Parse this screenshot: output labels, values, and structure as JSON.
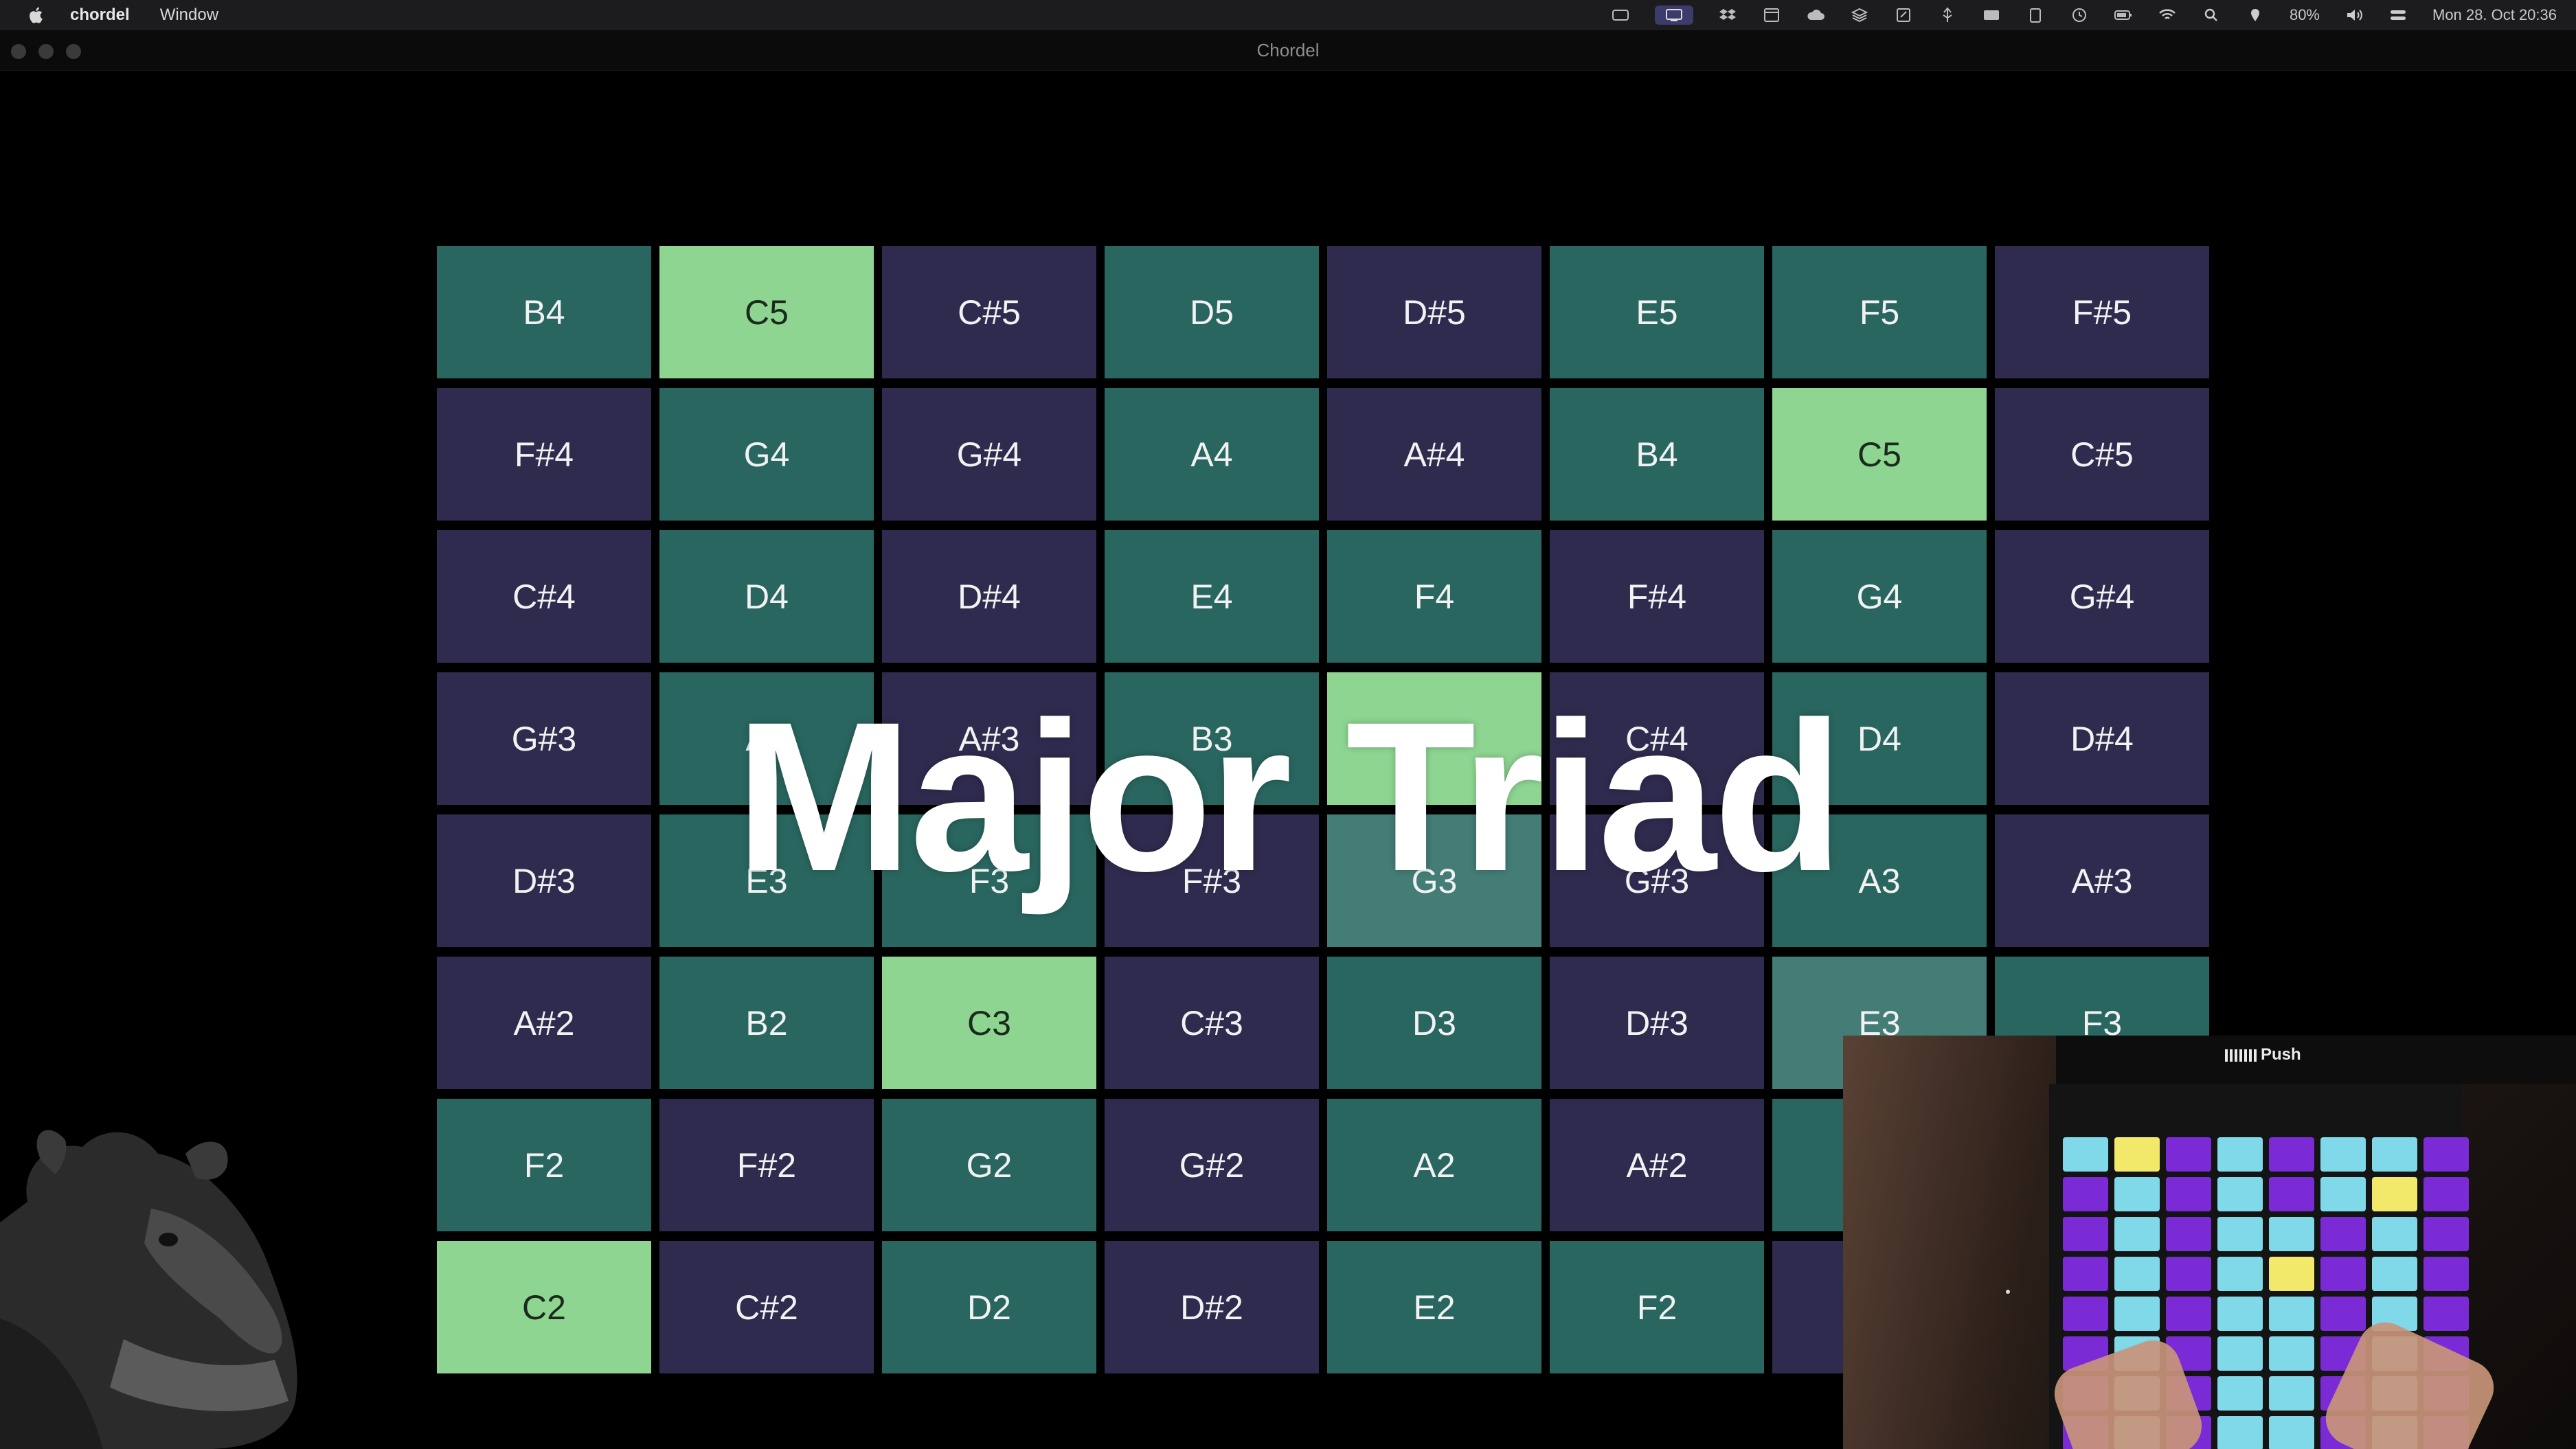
{
  "menubar": {
    "app_name": "chordel",
    "menus": [
      "Window"
    ],
    "battery": "80%",
    "datetime": "Mon 28. Oct  20:36",
    "status_icons": [
      "capture-icon",
      "screen-mirror-icon",
      "dropbox-icon",
      "calendar-icon",
      "cloud-icon",
      "stack-icon",
      "note-icon",
      "usb-icon",
      "card-icon",
      "clipboard-icon",
      "clock-icon",
      "battery-icon",
      "wifi-icon",
      "search-icon",
      "location-icon",
      "volume-icon",
      "control-center-icon"
    ]
  },
  "window": {
    "title": "Chordel"
  },
  "grid": {
    "rows": [
      [
        {
          "note": "B4",
          "kind": "natural"
        },
        {
          "note": "C5",
          "kind": "root"
        },
        {
          "note": "C#5",
          "kind": "sharp"
        },
        {
          "note": "D5",
          "kind": "natural"
        },
        {
          "note": "D#5",
          "kind": "sharp"
        },
        {
          "note": "E5",
          "kind": "natural"
        },
        {
          "note": "F5",
          "kind": "natural"
        },
        {
          "note": "F#5",
          "kind": "sharp"
        }
      ],
      [
        {
          "note": "F#4",
          "kind": "sharp"
        },
        {
          "note": "G4",
          "kind": "natural"
        },
        {
          "note": "G#4",
          "kind": "sharp"
        },
        {
          "note": "A4",
          "kind": "natural"
        },
        {
          "note": "A#4",
          "kind": "sharp"
        },
        {
          "note": "B4",
          "kind": "natural"
        },
        {
          "note": "C5",
          "kind": "root"
        },
        {
          "note": "C#5",
          "kind": "sharp"
        }
      ],
      [
        {
          "note": "C#4",
          "kind": "sharp"
        },
        {
          "note": "D4",
          "kind": "natural"
        },
        {
          "note": "D#4",
          "kind": "sharp"
        },
        {
          "note": "E4",
          "kind": "natural"
        },
        {
          "note": "F4",
          "kind": "natural"
        },
        {
          "note": "F#4",
          "kind": "sharp"
        },
        {
          "note": "G4",
          "kind": "natural"
        },
        {
          "note": "G#4",
          "kind": "sharp"
        }
      ],
      [
        {
          "note": "G#3",
          "kind": "sharp"
        },
        {
          "note": "A3",
          "kind": "natural"
        },
        {
          "note": "A#3",
          "kind": "sharp"
        },
        {
          "note": "B3",
          "kind": "natural"
        },
        {
          "note": "",
          "kind": "root"
        },
        {
          "note": "C#4",
          "kind": "sharp"
        },
        {
          "note": "D4",
          "kind": "natural"
        },
        {
          "note": "D#4",
          "kind": "sharp"
        }
      ],
      [
        {
          "note": "D#3",
          "kind": "sharp"
        },
        {
          "note": "E3",
          "kind": "natural"
        },
        {
          "note": "F3",
          "kind": "natural"
        },
        {
          "note": "F#3",
          "kind": "sharp"
        },
        {
          "note": "G3",
          "kind": "dim"
        },
        {
          "note": "G#3",
          "kind": "sharp"
        },
        {
          "note": "A3",
          "kind": "natural"
        },
        {
          "note": "A#3",
          "kind": "sharp"
        }
      ],
      [
        {
          "note": "A#2",
          "kind": "sharp"
        },
        {
          "note": "B2",
          "kind": "natural"
        },
        {
          "note": "C3",
          "kind": "root"
        },
        {
          "note": "C#3",
          "kind": "sharp"
        },
        {
          "note": "D3",
          "kind": "natural"
        },
        {
          "note": "D#3",
          "kind": "sharp"
        },
        {
          "note": "E3",
          "kind": "dim"
        },
        {
          "note": "F3",
          "kind": "natural"
        }
      ],
      [
        {
          "note": "F2",
          "kind": "natural"
        },
        {
          "note": "F#2",
          "kind": "sharp"
        },
        {
          "note": "G2",
          "kind": "natural"
        },
        {
          "note": "G#2",
          "kind": "sharp"
        },
        {
          "note": "A2",
          "kind": "natural"
        },
        {
          "note": "A#2",
          "kind": "sharp"
        },
        {
          "note": "",
          "kind": "natural"
        },
        {
          "note": "",
          "kind": "sharp"
        }
      ],
      [
        {
          "note": "C2",
          "kind": "root"
        },
        {
          "note": "C#2",
          "kind": "sharp"
        },
        {
          "note": "D2",
          "kind": "natural"
        },
        {
          "note": "D#2",
          "kind": "sharp"
        },
        {
          "note": "E2",
          "kind": "natural"
        },
        {
          "note": "F2",
          "kind": "natural"
        },
        {
          "note": "",
          "kind": "sharp"
        },
        {
          "note": "",
          "kind": "natural"
        }
      ]
    ]
  },
  "overlay": {
    "chord_name": "Major Triad"
  },
  "camera": {
    "device_label": "Push",
    "pads": [
      [
        "cyan",
        "yellow",
        "purple",
        "cyan",
        "purple",
        "cyan",
        "cyan",
        "purple"
      ],
      [
        "purple",
        "cyan",
        "purple",
        "cyan",
        "purple",
        "cyan",
        "yellow",
        "purple"
      ],
      [
        "purple",
        "cyan",
        "purple",
        "cyan",
        "cyan",
        "purple",
        "cyan",
        "purple"
      ],
      [
        "purple",
        "cyan",
        "purple",
        "cyan",
        "yellow",
        "purple",
        "cyan",
        "purple"
      ],
      [
        "purple",
        "cyan",
        "purple",
        "cyan",
        "cyan",
        "purple",
        "cyan",
        "purple"
      ],
      [
        "purple",
        "cyan",
        "purple",
        "cyan",
        "cyan",
        "purple",
        "cyan",
        "purple"
      ],
      [
        "purple",
        "cyan",
        "purple",
        "cyan",
        "cyan",
        "purple",
        "cyan",
        "purple"
      ],
      [
        "purple",
        "cyan",
        "purple",
        "cyan",
        "cyan",
        "purple",
        "cyan",
        "purple"
      ]
    ]
  }
}
